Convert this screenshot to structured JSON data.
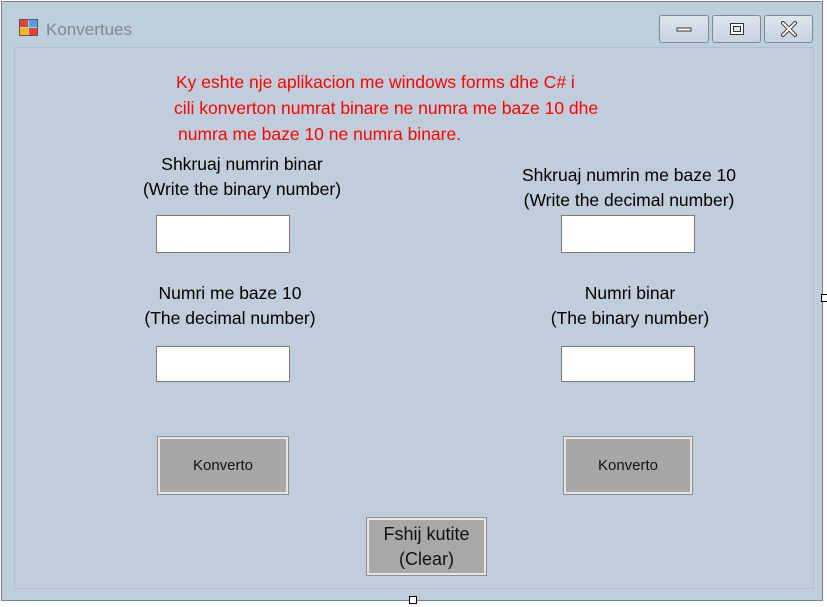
{
  "window": {
    "title": "Konvertues"
  },
  "description": {
    "line1": "Ky eshte nje aplikacion me windows forms dhe C# i",
    "line2": "cili konverton numrat binare ne numra me baze 10 dhe",
    "line3": " numra me baze 10 ne numra binare."
  },
  "left": {
    "input_label_1": "Shkruaj numrin binar",
    "input_label_2": "(Write the binary number)",
    "input_value": "",
    "output_label_1": "Numri me baze 10",
    "output_label_2": "(The decimal number)",
    "output_value": "",
    "button_label": "Konverto"
  },
  "right": {
    "input_label_1": "Shkruaj numrin me baze 10",
    "input_label_2": "(Write the decimal number)",
    "input_value": "",
    "output_label_1": "Numri binar",
    "output_label_2": "(The binary number)",
    "output_value": "",
    "button_label": "Konverto"
  },
  "clear_button": {
    "line1": "Fshij kutite",
    "line2": "(Clear)"
  },
  "colors": {
    "client_bg": "#c0cedb",
    "description_text": "#ff0000",
    "button_bg": "#a7a7a7"
  }
}
